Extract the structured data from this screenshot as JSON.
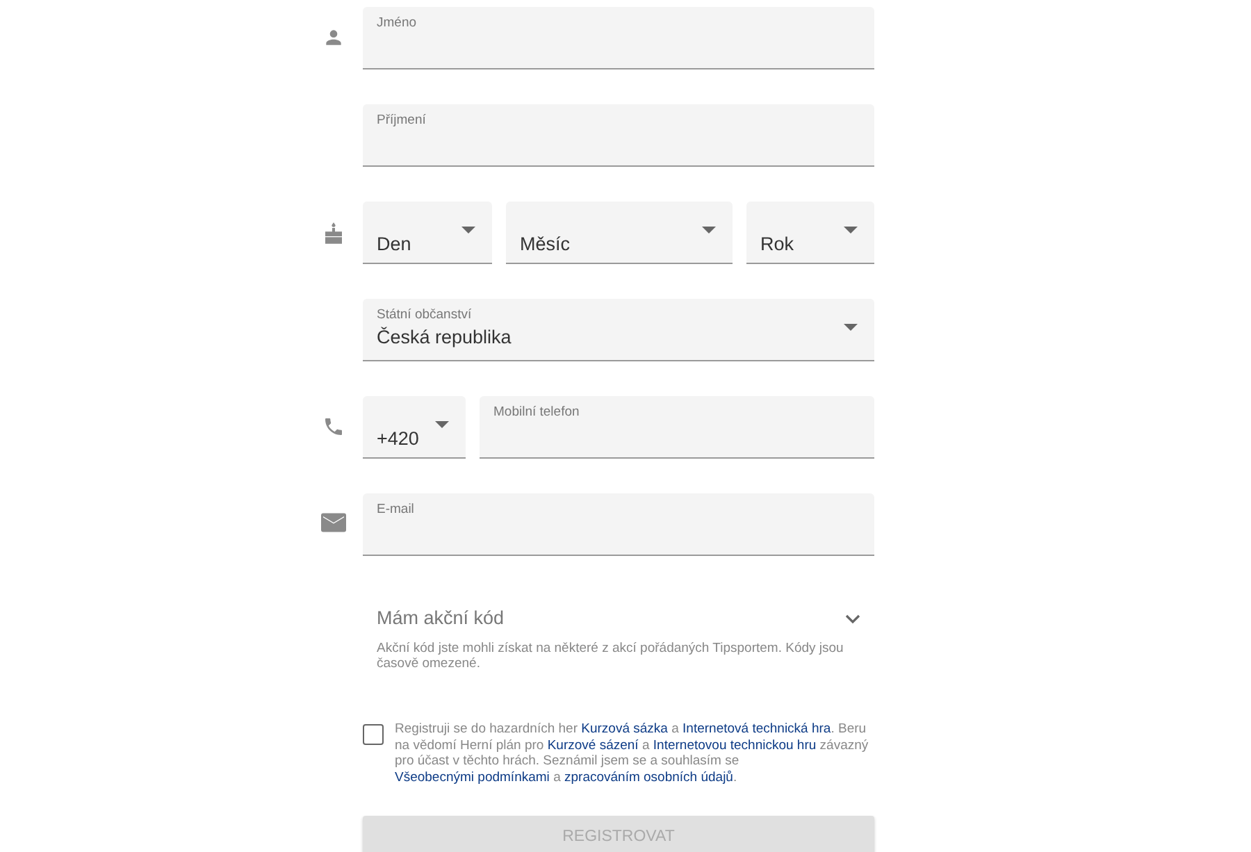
{
  "rows": [
    {
      "kind": "name",
      "fields": [
        {
          "kind": "text",
          "label": "Jméno"
        }
      ]
    },
    {
      "kind": "surname",
      "fields": [
        {
          "kind": "text",
          "label": "Příjmení"
        }
      ]
    },
    {
      "kind": "birthdate",
      "fields": [
        {
          "kind": "select",
          "value": "Den"
        },
        {
          "kind": "select",
          "value": "Měsíc"
        },
        {
          "kind": "select",
          "value": "Rok"
        }
      ]
    },
    {
      "kind": "citizenship",
      "fields": [
        {
          "kind": "select",
          "label": "Státní občanství",
          "value": "Česká republika"
        }
      ]
    },
    {
      "kind": "phone",
      "fields": [
        {
          "kind": "select",
          "value": "+420"
        },
        {
          "kind": "text",
          "label": "Mobilní telefon"
        }
      ]
    },
    {
      "kind": "email",
      "fields": [
        {
          "kind": "text",
          "label": "E-mail"
        }
      ]
    }
  ],
  "promo": {
    "title": "Mám akční kód",
    "expanded": false,
    "help": "Akční kód jste mohli získat na některé z akcí pořádaných Tipsportem. Kódy jsou časově omezené."
  },
  "consent": {
    "checked": false,
    "segments": [
      {
        "kind": "text",
        "text": "Registruji se do hazardních her"
      },
      {
        "kind": "link",
        "text": "Kurzová sázka"
      },
      {
        "kind": "text",
        "text": "a"
      },
      {
        "kind": "link",
        "text": "Internetová technická hra"
      },
      {
        "kind": "text",
        "text": ". Beru na vědomí Herní plán pro"
      },
      {
        "kind": "link",
        "text": "Kurzové sázení"
      },
      {
        "kind": "text",
        "text": "a"
      },
      {
        "kind": "link",
        "text": "Internetovou technickou hru"
      },
      {
        "kind": "text",
        "text": "závazný pro účast v těchto hrách. Seznámil jsem se a souhlasím se"
      },
      {
        "kind": "link",
        "text": "Všeobecnými podmínkami"
      },
      {
        "kind": "text",
        "text": "a"
      },
      {
        "kind": "link",
        "text": "zpracováním osobních údajů"
      },
      {
        "kind": "text",
        "text": "."
      }
    ]
  },
  "submit": {
    "label": "REGISTROVAT",
    "disabled": true
  }
}
